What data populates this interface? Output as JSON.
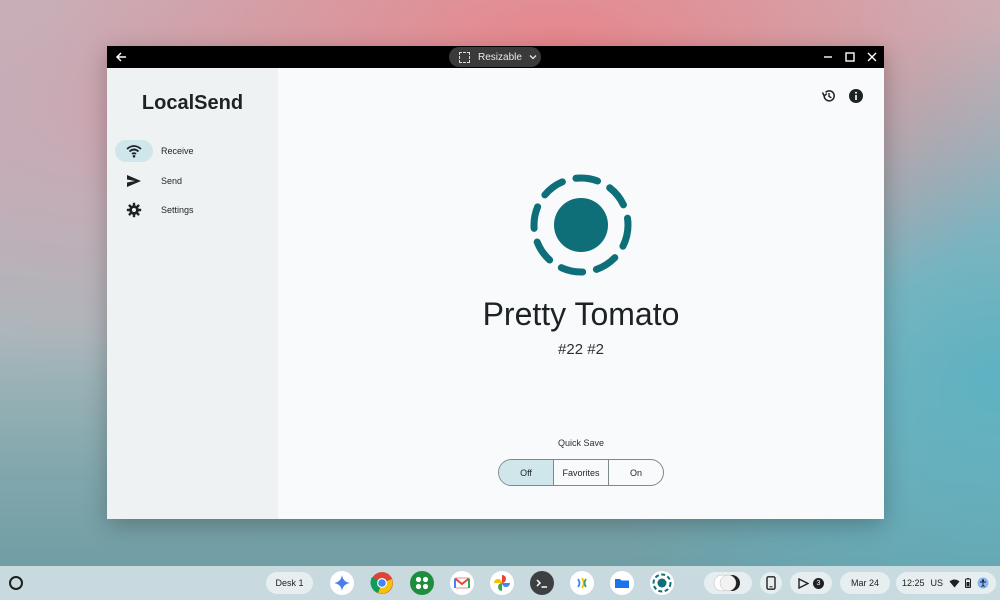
{
  "window": {
    "resizable_label": "Resizable",
    "app_title": "LocalSend"
  },
  "sidebar": {
    "items": [
      {
        "label": "Receive",
        "icon": "wifi-icon",
        "active": true
      },
      {
        "label": "Send",
        "icon": "send-icon",
        "active": false
      },
      {
        "label": "Settings",
        "icon": "gear-icon",
        "active": false
      }
    ]
  },
  "main": {
    "device_name": "Pretty Tomato",
    "device_id": "#22 #2",
    "quick_save": {
      "label": "Quick Save",
      "options": [
        "Off",
        "Favorites",
        "On"
      ],
      "selected": "Off"
    }
  },
  "shelf": {
    "desk_label": "Desk 1",
    "notification_count": "3",
    "date": "Mar 24",
    "time": "12:25",
    "locale": "US"
  },
  "colors": {
    "accent": "#0e6f78",
    "selected_bg": "#cfe6ea",
    "sidebar_bg": "#eef2f3"
  }
}
